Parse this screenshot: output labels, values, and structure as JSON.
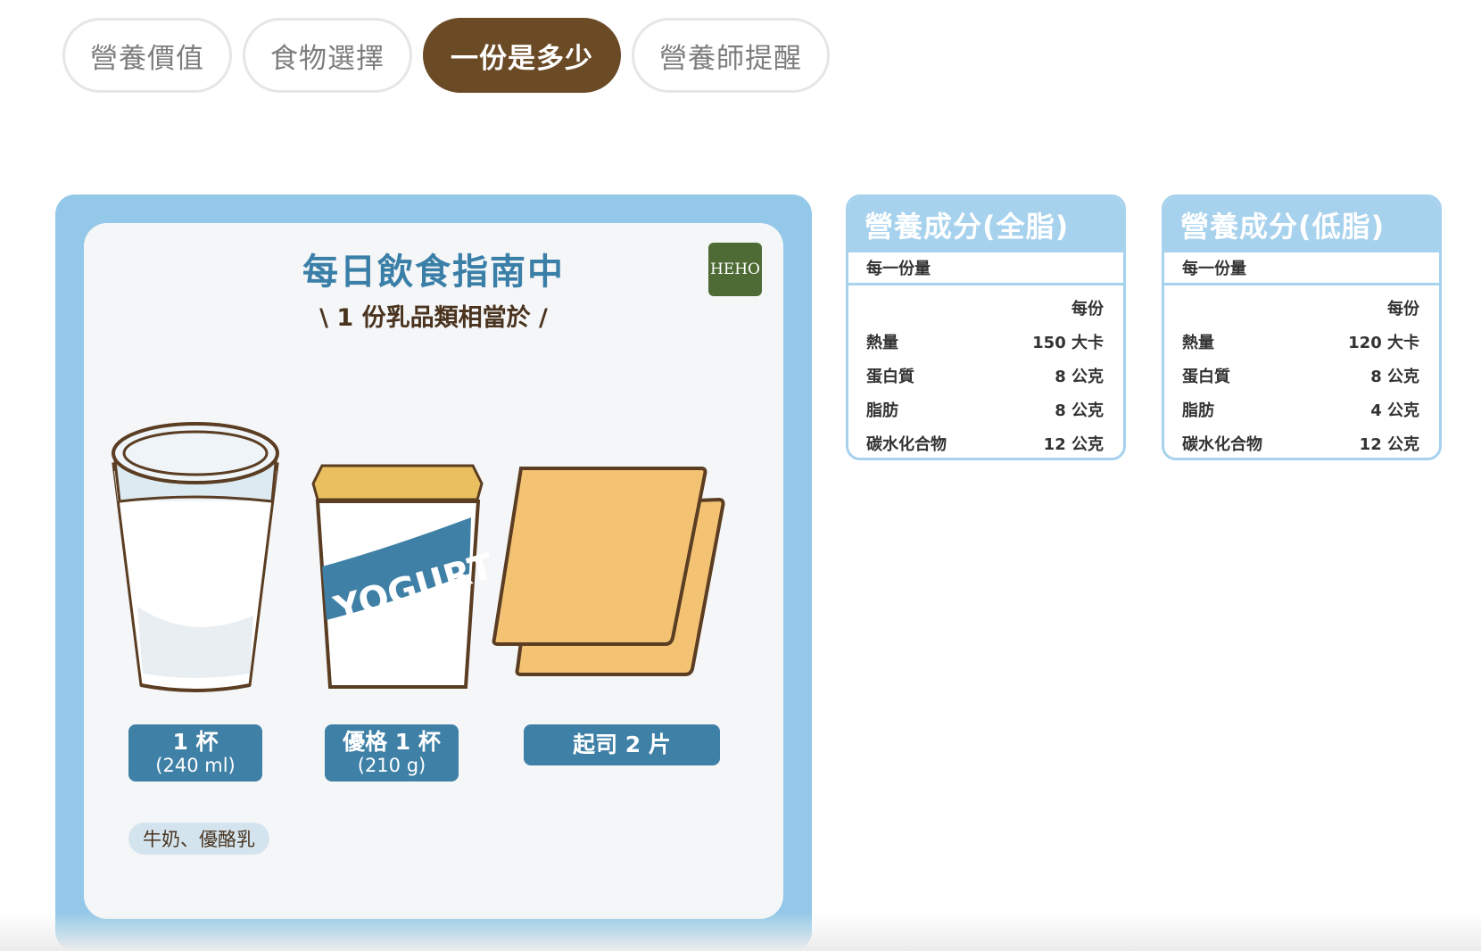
{
  "tabs": [
    {
      "label": "營養價值",
      "active": false
    },
    {
      "label": "食物選擇",
      "active": false
    },
    {
      "label": "一份是多少",
      "active": true
    },
    {
      "label": "營養師提醒",
      "active": false
    }
  ],
  "infographic": {
    "title": "每日飲食指南中",
    "subtitle": "\\ 1 份乳品類相當於 /",
    "logo": "HEHO",
    "yogurt_print": "YOGURT",
    "items": [
      {
        "name": "milk",
        "label_main": "1 杯",
        "label_sub": "(240 ml)",
        "tag": "牛奶、優酪乳"
      },
      {
        "name": "yogurt",
        "label_main": "優格 1 杯",
        "label_sub": "(210 g)"
      },
      {
        "name": "cheese",
        "label_main": "起司 2 片"
      }
    ]
  },
  "nutrition": [
    {
      "title": "營養成分(全脂)",
      "per_label": "每一份量",
      "col_header": "每份",
      "rows": [
        {
          "name": "熱量",
          "value": "150 大卡"
        },
        {
          "name": "蛋白質",
          "value": "8 公克"
        },
        {
          "name": "脂肪",
          "value": "8 公克"
        },
        {
          "name": "碳水化合物",
          "value": "12 公克"
        }
      ]
    },
    {
      "title": "營養成分(低脂)",
      "per_label": "每一份量",
      "col_header": "每份",
      "rows": [
        {
          "name": "熱量",
          "value": "120 大卡"
        },
        {
          "name": "蛋白質",
          "value": "8 公克"
        },
        {
          "name": "脂肪",
          "value": "4 公克"
        },
        {
          "name": "碳水化合物",
          "value": "12 公克"
        }
      ]
    }
  ],
  "colors": {
    "active_tab": "#6b4a26",
    "frame_blue": "#93c8e8",
    "label_blue": "#3f80a6",
    "table_blue": "#a7d2ee",
    "cheese": "#f3c373",
    "yogurt_lid": "#e9bf5f",
    "outline": "#5a3d22"
  }
}
